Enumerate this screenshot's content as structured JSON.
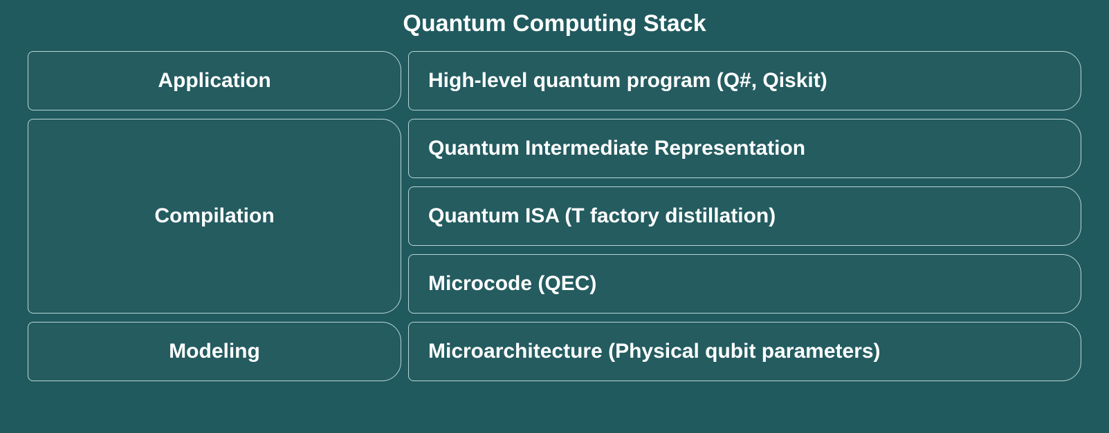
{
  "title": "Quantum Computing Stack",
  "rows": {
    "application": {
      "left": "Application",
      "right": "High-level quantum program (Q#, Qiskit)"
    },
    "compilation": {
      "left": "Compilation",
      "right1": "Quantum Intermediate Representation",
      "right2": "Quantum ISA (T factory distillation)",
      "right3": "Microcode (QEC)"
    },
    "modeling": {
      "left": "Modeling",
      "right": "Microarchitecture (Physical qubit parameters)"
    }
  }
}
